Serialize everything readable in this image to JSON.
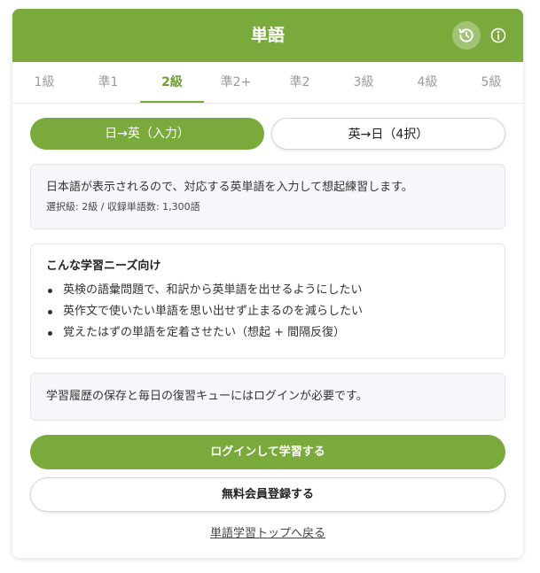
{
  "header": {
    "title": "単語",
    "history_icon": "history-icon",
    "info_icon": "info-icon"
  },
  "tabs": [
    {
      "label": "1級",
      "active": false
    },
    {
      "label": "準1",
      "active": false
    },
    {
      "label": "2級",
      "active": true
    },
    {
      "label": "準2+",
      "active": false
    },
    {
      "label": "準2",
      "active": false
    },
    {
      "label": "3級",
      "active": false
    },
    {
      "label": "4級",
      "active": false
    },
    {
      "label": "5級",
      "active": false
    }
  ],
  "modes": {
    "jp_to_en": "日→英（入力）",
    "en_to_jp": "英→日（4択）"
  },
  "description": {
    "main": "日本語が表示されるので、対応する英単語を入力して想起練習します。",
    "sub": "選択級: 2級 / 収録単語数: 1,300語"
  },
  "needs": {
    "title": "こんな学習ニーズ向け",
    "items": [
      "英検の語彙問題で、和訳から英単語を出せるようにしたい",
      "英作文で使いたい単語を思い出せず止まるのを減らしたい",
      "覚えたはずの単語を定着させたい（想起 + 間隔反復）"
    ]
  },
  "login_note": "学習履歴の保存と毎日の復習キューにはログインが必要です。",
  "buttons": {
    "login": "ログインして学習する",
    "register": "無料会員登録する"
  },
  "back_link": "単語学習トップへ戻る",
  "colors": {
    "accent": "#7aaa3c",
    "muted_tab": "#9a9a9a",
    "panel_bg": "#f6f7fa"
  }
}
